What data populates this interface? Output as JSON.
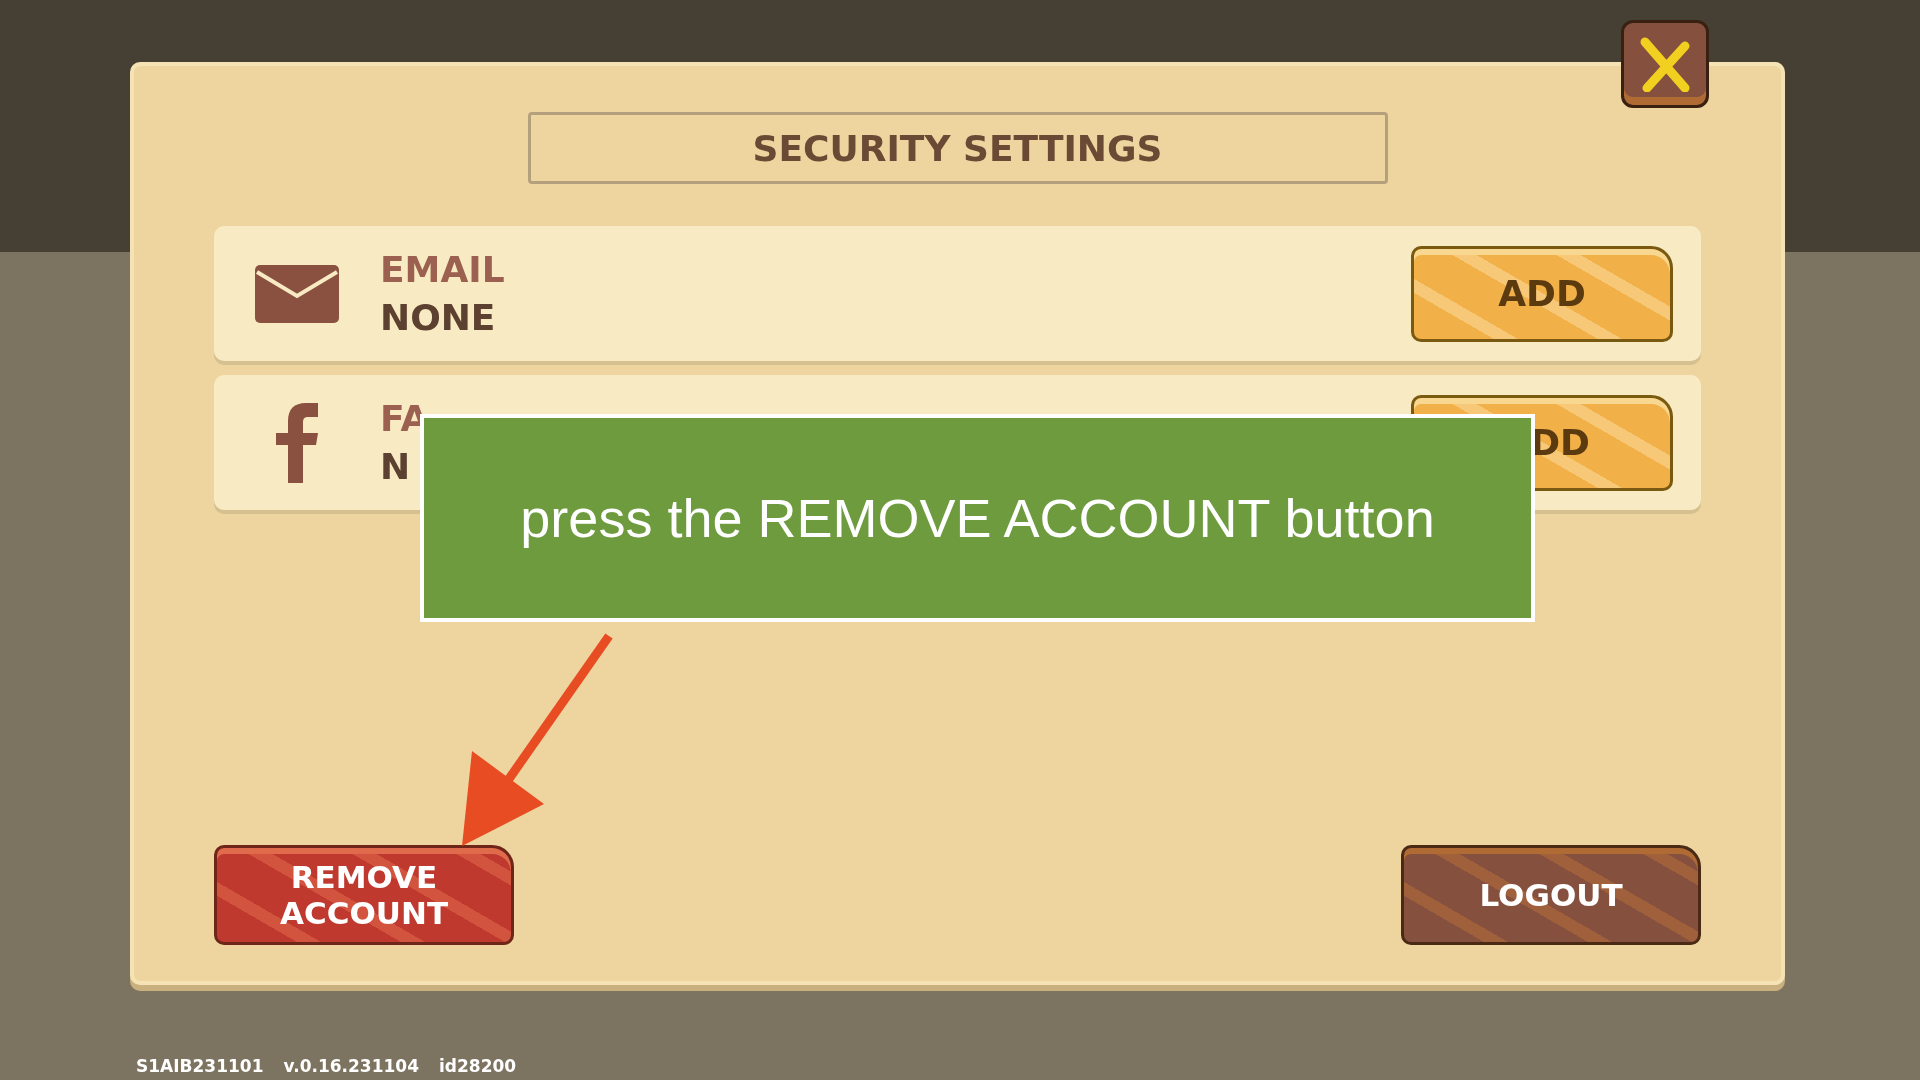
{
  "dialog": {
    "title": "SECURITY SETTINGS"
  },
  "accounts": [
    {
      "kind": "email",
      "label": "EMAIL",
      "value": "NONE",
      "button": "ADD"
    },
    {
      "kind": "facebook",
      "label": "FA",
      "value": "N",
      "button": "DD"
    }
  ],
  "actions": [
    {
      "kind": "danger",
      "label": "REMOVE ACCOUNT"
    },
    {
      "kind": "normal",
      "label": "LOGOUT"
    }
  ],
  "overlay": {
    "text": "press the REMOVE ACCOUNT button"
  },
  "status_bar": [
    "S1AIB231101",
    "v.0.16.231104",
    "id28200"
  ]
}
